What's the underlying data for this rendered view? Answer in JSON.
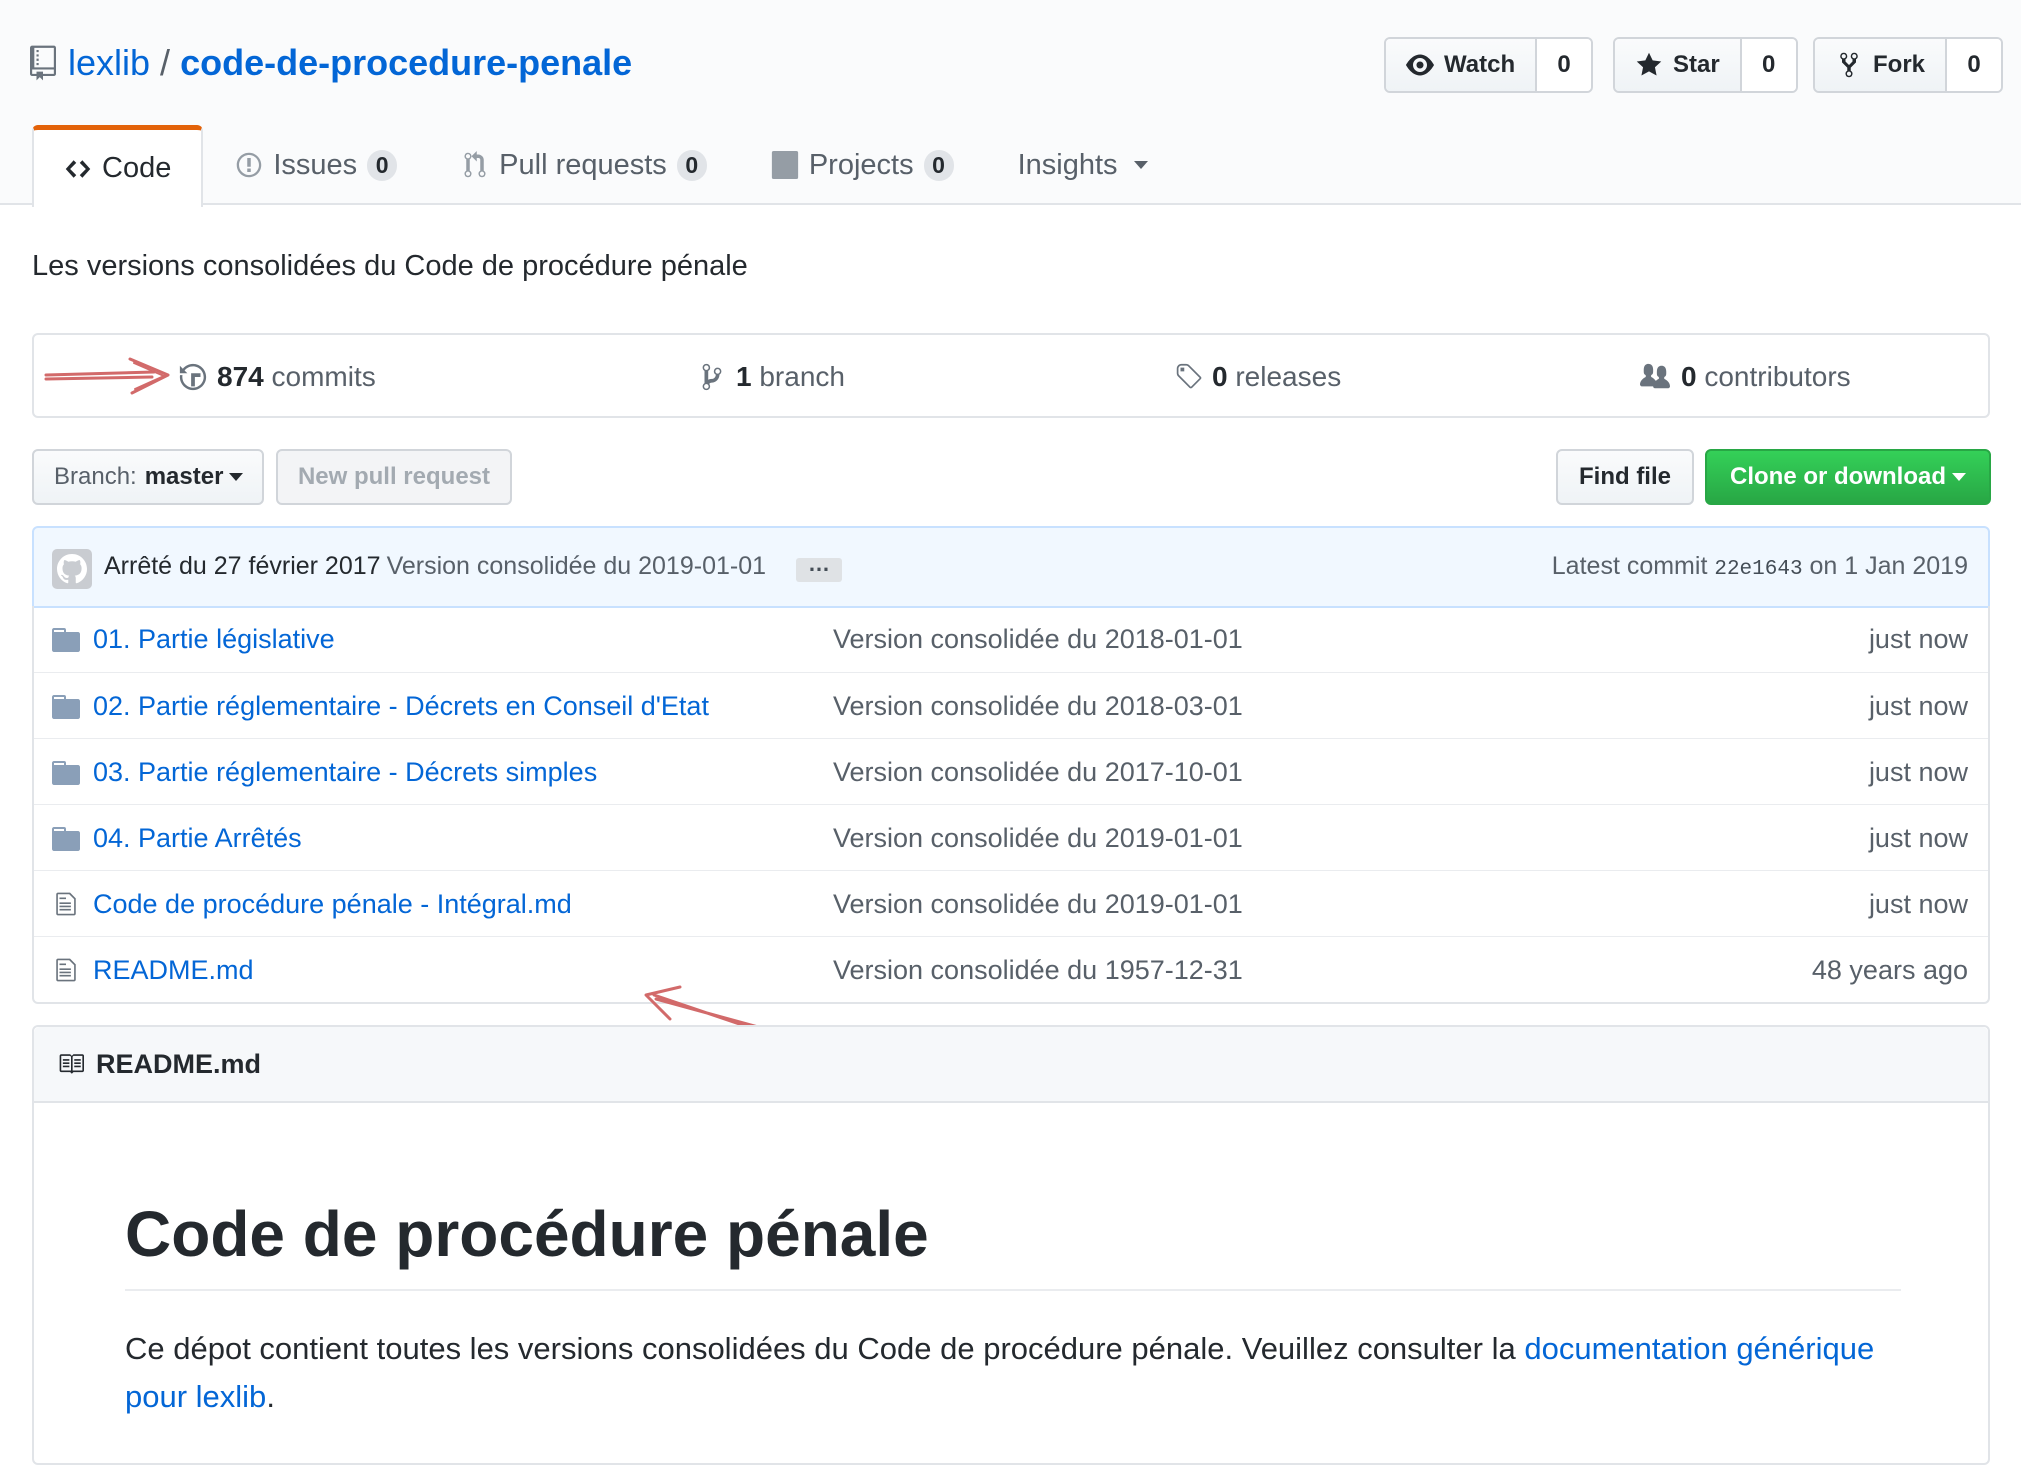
{
  "repo": {
    "owner": "lexlib",
    "separator": "/",
    "name": "code-de-procedure-penale"
  },
  "actions": {
    "watch": {
      "label": "Watch",
      "count": "0"
    },
    "star": {
      "label": "Star",
      "count": "0"
    },
    "fork": {
      "label": "Fork",
      "count": "0"
    }
  },
  "tabs": [
    {
      "label": "Code",
      "icon": "code-icon"
    },
    {
      "label": "Issues",
      "count": "0",
      "icon": "issue-icon"
    },
    {
      "label": "Pull requests",
      "count": "0",
      "icon": "pull-request-icon"
    },
    {
      "label": "Projects",
      "count": "0",
      "icon": "project-icon"
    },
    {
      "label": "Insights",
      "icon": "caret-down-icon"
    }
  ],
  "description": "Les versions consolidées du Code de procédure pénale",
  "summary": {
    "commits": {
      "count": "874",
      "label": "commits"
    },
    "branches": {
      "count": "1",
      "label": "branch"
    },
    "releases": {
      "count": "0",
      "label": "releases"
    },
    "contributors": {
      "count": "0",
      "label": "contributors"
    }
  },
  "file_nav": {
    "branch_prefix": "Branch:",
    "branch_name": "master",
    "new_pr": "New pull request",
    "find_file": "Find file",
    "clone": "Clone or download"
  },
  "commit": {
    "message": "Arrêté du 27 février 2017",
    "version": "Version consolidée du 2019-01-01",
    "ellipsis": "…",
    "latest_prefix": "Latest commit",
    "sha": "22e1643",
    "date": "on 1 Jan 2019"
  },
  "files": [
    {
      "type": "folder",
      "name": "01. Partie législative",
      "message": "Version consolidée du 2018-01-01",
      "age": "just now"
    },
    {
      "type": "folder",
      "name": "02. Partie réglementaire - Décrets en Conseil d'Etat",
      "message": "Version consolidée du 2018-03-01",
      "age": "just now"
    },
    {
      "type": "folder",
      "name": "03. Partie réglementaire - Décrets simples",
      "message": "Version consolidée du 2017-10-01",
      "age": "just now"
    },
    {
      "type": "folder",
      "name": "04. Partie Arrêtés",
      "message": "Version consolidée du 2019-01-01",
      "age": "just now"
    },
    {
      "type": "file",
      "name": "Code de procédure pénale - Intégral.md",
      "message": "Version consolidée du 2019-01-01",
      "age": "just now"
    },
    {
      "type": "file",
      "name": "README.md",
      "message": "Version consolidée du 1957-12-31",
      "age": "48 years ago"
    }
  ],
  "readme": {
    "filename": "README.md",
    "title": "Code de procédure pénale",
    "text_before": "Ce dépot contient toutes les versions consolidées du Code de procédure pénale. Veuillez consulter la ",
    "link": "documentation générique pour lexlib",
    "text_after": "."
  },
  "colors": {
    "link": "#0366d6",
    "tab_accent": "#e36209",
    "clone_green": "#28a745",
    "annotation_arrow": "#d26a6a"
  }
}
